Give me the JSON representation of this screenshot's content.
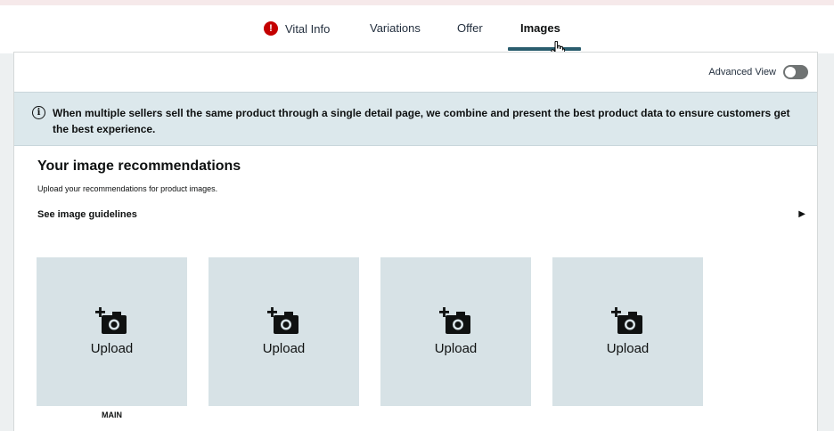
{
  "tabs": [
    {
      "label": "Vital Info",
      "error": true
    },
    {
      "label": "Variations"
    },
    {
      "label": "Offer"
    },
    {
      "label": "Images",
      "active": true
    }
  ],
  "advanced_view": {
    "label": "Advanced View",
    "enabled": false
  },
  "info_banner": {
    "text": "When multiple sellers sell the same product through a single detail page, we combine and present the best product data to ensure customers get the best experience."
  },
  "recommendations": {
    "title": "Your image recommendations",
    "subtitle": "Upload your recommendations for product images.",
    "guidelines_link": "See image guidelines"
  },
  "image_slots": [
    {
      "upload_label": "Upload",
      "slot_label": "MAIN"
    },
    {
      "upload_label": "Upload",
      "slot_label": ""
    },
    {
      "upload_label": "Upload",
      "slot_label": ""
    },
    {
      "upload_label": "Upload",
      "slot_label": ""
    }
  ],
  "colors": {
    "active_tab_underline": "#2a5d6e",
    "error_icon": "#c40000",
    "info_banner_bg": "#dce8ec",
    "upload_slot_bg": "#d7e2e6"
  }
}
